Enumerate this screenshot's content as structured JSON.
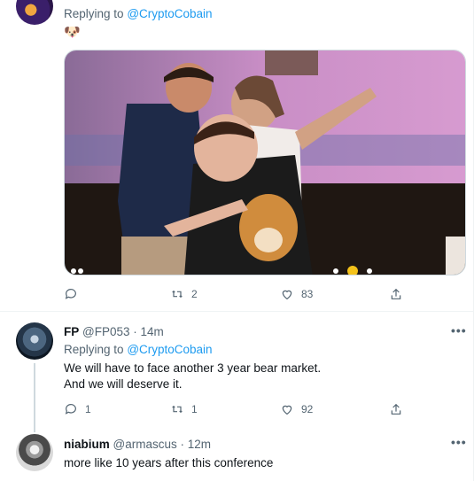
{
  "tweets": [
    {
      "reply_prefix": "Replying to",
      "reply_handle": "@CryptoCobain",
      "emoji": "🐶",
      "media_alt": "Meme image",
      "actions": {
        "reply": "",
        "retweet": "2",
        "like": "83"
      }
    },
    {
      "name": "FP",
      "handle": "@FP053",
      "time": "· 14m",
      "reply_prefix": "Replying to",
      "reply_handle": "@CryptoCobain",
      "text_line1": "We will have to face another 3 year bear market.",
      "text_line2": "And we will deserve it.",
      "actions": {
        "reply": "1",
        "retweet": "1",
        "like": "92"
      }
    },
    {
      "name": "niabium",
      "handle": "@armascus",
      "time": "· 12m",
      "text": "more like 10 years after this conference"
    }
  ],
  "more_label": "•••",
  "colors": {
    "accent": "#1d9bf0",
    "muted": "#536471",
    "divider": "#eff3f4"
  },
  "icons": [
    "reply-icon",
    "retweet-icon",
    "like-icon",
    "share-icon",
    "more-icon"
  ]
}
